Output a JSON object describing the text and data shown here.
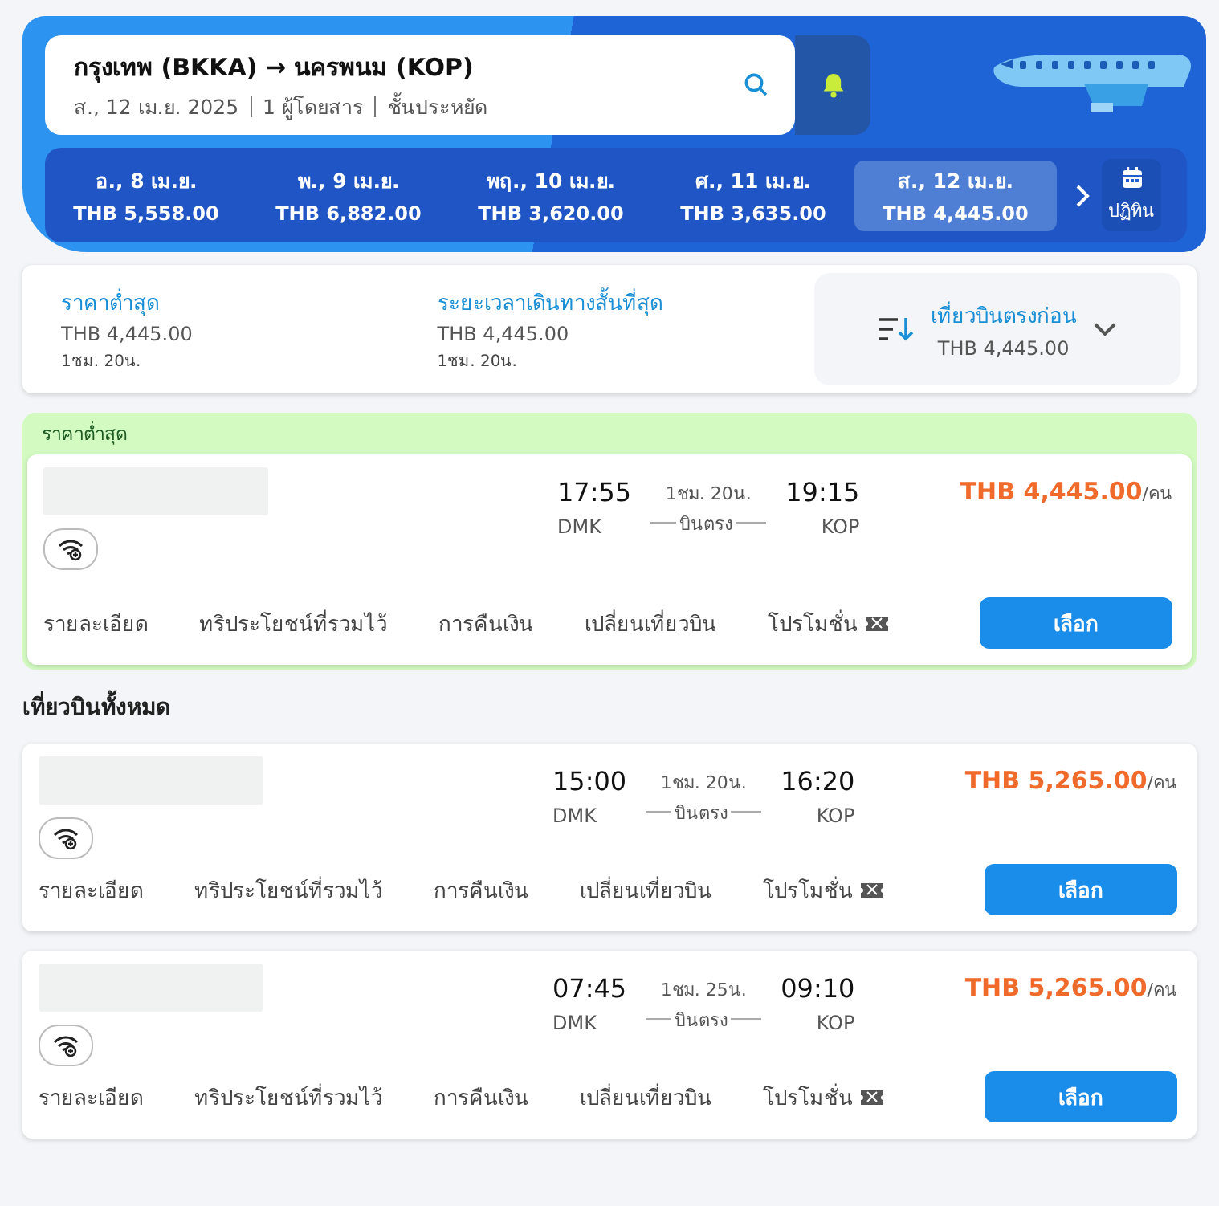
{
  "search": {
    "route": "กรุงเทพ (BKKA) → นครพนม (KOP)",
    "details": [
      "ส., 12 เม.ย. 2025",
      "1 ผู้โดยสาร",
      "ชั้นประหยัด"
    ]
  },
  "dates": [
    {
      "day": "อ., 8 เม.ย.",
      "price": "THB 5,558.00",
      "selected": false
    },
    {
      "day": "พ., 9 เม.ย.",
      "price": "THB 6,882.00",
      "selected": false
    },
    {
      "day": "พฤ., 10 เม.ย.",
      "price": "THB 3,620.00",
      "selected": false
    },
    {
      "day": "ศ., 11 เม.ย.",
      "price": "THB 3,635.00",
      "selected": false
    },
    {
      "day": "ส., 12 เม.ย.",
      "price": "THB 4,445.00",
      "selected": true
    }
  ],
  "calendar_label": "ปฏิทิน",
  "summary": [
    {
      "title": "ราคาต่ำสุด",
      "price": "THB 4,445.00",
      "duration": "1ชม. 20น."
    },
    {
      "title": "ระยะเวลาเดินทางสั้นที่สุด",
      "price": "THB 4,445.00",
      "duration": "1ชม. 20น."
    }
  ],
  "sort": {
    "label": "เที่ยวบินตรงก่อน",
    "price": "THB 4,445.00"
  },
  "all_flights_heading": "เที่ยวบินทั้งหมด",
  "flights": [
    {
      "badge": "ราคาต่ำสุด",
      "depart": "17:55",
      "from": "DMK",
      "duration": "1ชม. 20น.",
      "stops": "บินตรง",
      "arrive": "19:15",
      "to": "KOP",
      "price": "THB 4,445.00",
      "unit": "/คน",
      "links": [
        "รายละเอียด",
        "ทริประโยชน์ที่รวมไว้",
        "การคืนเงิน",
        "เปลี่ยนเที่ยวบิน",
        "โปรโมชั่น"
      ],
      "button": "เลือก"
    },
    {
      "depart": "15:00",
      "from": "DMK",
      "duration": "1ชม. 20น.",
      "stops": "บินตรง",
      "arrive": "16:20",
      "to": "KOP",
      "price": "THB 5,265.00",
      "unit": "/คน",
      "links": [
        "รายละเอียด",
        "ทริประโยชน์ที่รวมไว้",
        "การคืนเงิน",
        "เปลี่ยนเที่ยวบิน",
        "โปรโมชั่น"
      ],
      "button": "เลือก"
    },
    {
      "depart": "07:45",
      "from": "DMK",
      "duration": "1ชม. 25น.",
      "stops": "บินตรง",
      "arrive": "09:10",
      "to": "KOP",
      "price": "THB 5,265.00",
      "unit": "/คน",
      "links": [
        "รายละเอียด",
        "ทริประโยชน์ที่รวมไว้",
        "การคืนเงิน",
        "เปลี่ยนเที่ยวบิน",
        "โปรโมชั่น"
      ],
      "button": "เลือก"
    }
  ]
}
